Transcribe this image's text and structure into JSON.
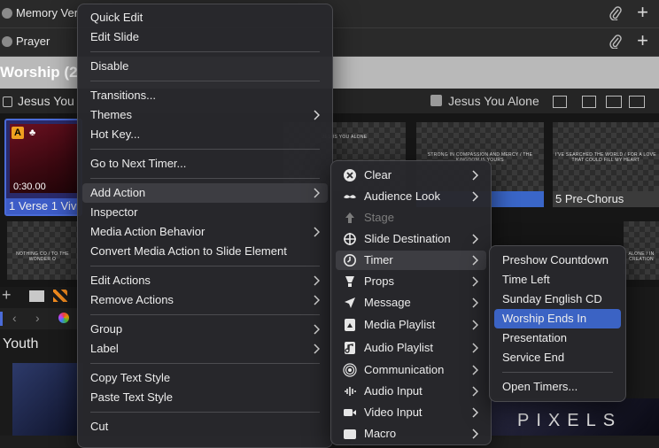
{
  "top_rows": [
    {
      "label": "Memory Ver"
    },
    {
      "label": "Prayer"
    }
  ],
  "playlist_header": {
    "title": "Worship (2"
  },
  "song_bar": {
    "left_title": "Jesus You",
    "right_title": "Jesus You Alone"
  },
  "slides": [
    {
      "badge": "A",
      "time": "0:30.00",
      "label": "1 Verse 1 Viv"
    },
    {
      "caption": "JESUS YOU ALONE"
    },
    {
      "caption": "STRONG IN COMPASSION AND MERCY / THE KINGDOM IS YOURS"
    },
    {
      "caption": "I'VE SEARCHED THE WORLD / FOR A LOVE THAT COULD FILL MY HEART",
      "label": "5 Pre-Chorus"
    },
    {
      "caption": "NOTHING CO / TO THE WONDER O"
    },
    {
      "caption": "ALONE / IN CREATION"
    }
  ],
  "bottom": {
    "section_title": "Youth",
    "watermark": "PIXELS"
  },
  "main_menu": {
    "items": [
      {
        "label": "Quick Edit"
      },
      {
        "label": "Edit Slide"
      },
      {
        "label": "Disable"
      },
      {
        "label": "Transitions..."
      },
      {
        "label": "Themes",
        "submenu": true
      },
      {
        "label": "Hot Key..."
      },
      {
        "label": "Go to Next Timer..."
      },
      {
        "label": "Add Action",
        "submenu": true
      },
      {
        "label": "Inspector"
      },
      {
        "label": "Media Action Behavior",
        "submenu": true
      },
      {
        "label": "Convert Media Action to Slide Element"
      },
      {
        "label": "Edit Actions",
        "submenu": true
      },
      {
        "label": "Remove Actions",
        "submenu": true
      },
      {
        "label": "Group",
        "submenu": true
      },
      {
        "label": "Label",
        "submenu": true
      },
      {
        "label": "Copy Text Style"
      },
      {
        "label": "Paste Text Style"
      },
      {
        "label": "Cut"
      }
    ]
  },
  "action_menu": {
    "items": [
      {
        "label": "Clear",
        "icon": "clear-icon"
      },
      {
        "label": "Audience Look",
        "icon": "mustache-icon"
      },
      {
        "label": "Stage",
        "icon": "stage-icon"
      },
      {
        "label": "Slide Destination",
        "icon": "crosshair-icon"
      },
      {
        "label": "Timer",
        "icon": "timer-icon"
      },
      {
        "label": "Props",
        "icon": "props-icon"
      },
      {
        "label": "Message",
        "icon": "message-icon"
      },
      {
        "label": "Media Playlist",
        "icon": "media-playlist-icon"
      },
      {
        "label": "Audio Playlist",
        "icon": "audio-playlist-icon"
      },
      {
        "label": "Communication",
        "icon": "communication-icon"
      },
      {
        "label": "Audio Input",
        "icon": "audio-input-icon"
      },
      {
        "label": "Video Input",
        "icon": "video-input-icon"
      },
      {
        "label": "Macro",
        "icon": "macro-icon"
      }
    ]
  },
  "timer_menu": {
    "items": [
      {
        "label": "Preshow Countdown"
      },
      {
        "label": "Time Left"
      },
      {
        "label": "Sunday English CD"
      },
      {
        "label": "Worship Ends In"
      },
      {
        "label": "Presentation"
      },
      {
        "label": "Service End"
      },
      {
        "label": "Open Timers..."
      }
    ]
  }
}
